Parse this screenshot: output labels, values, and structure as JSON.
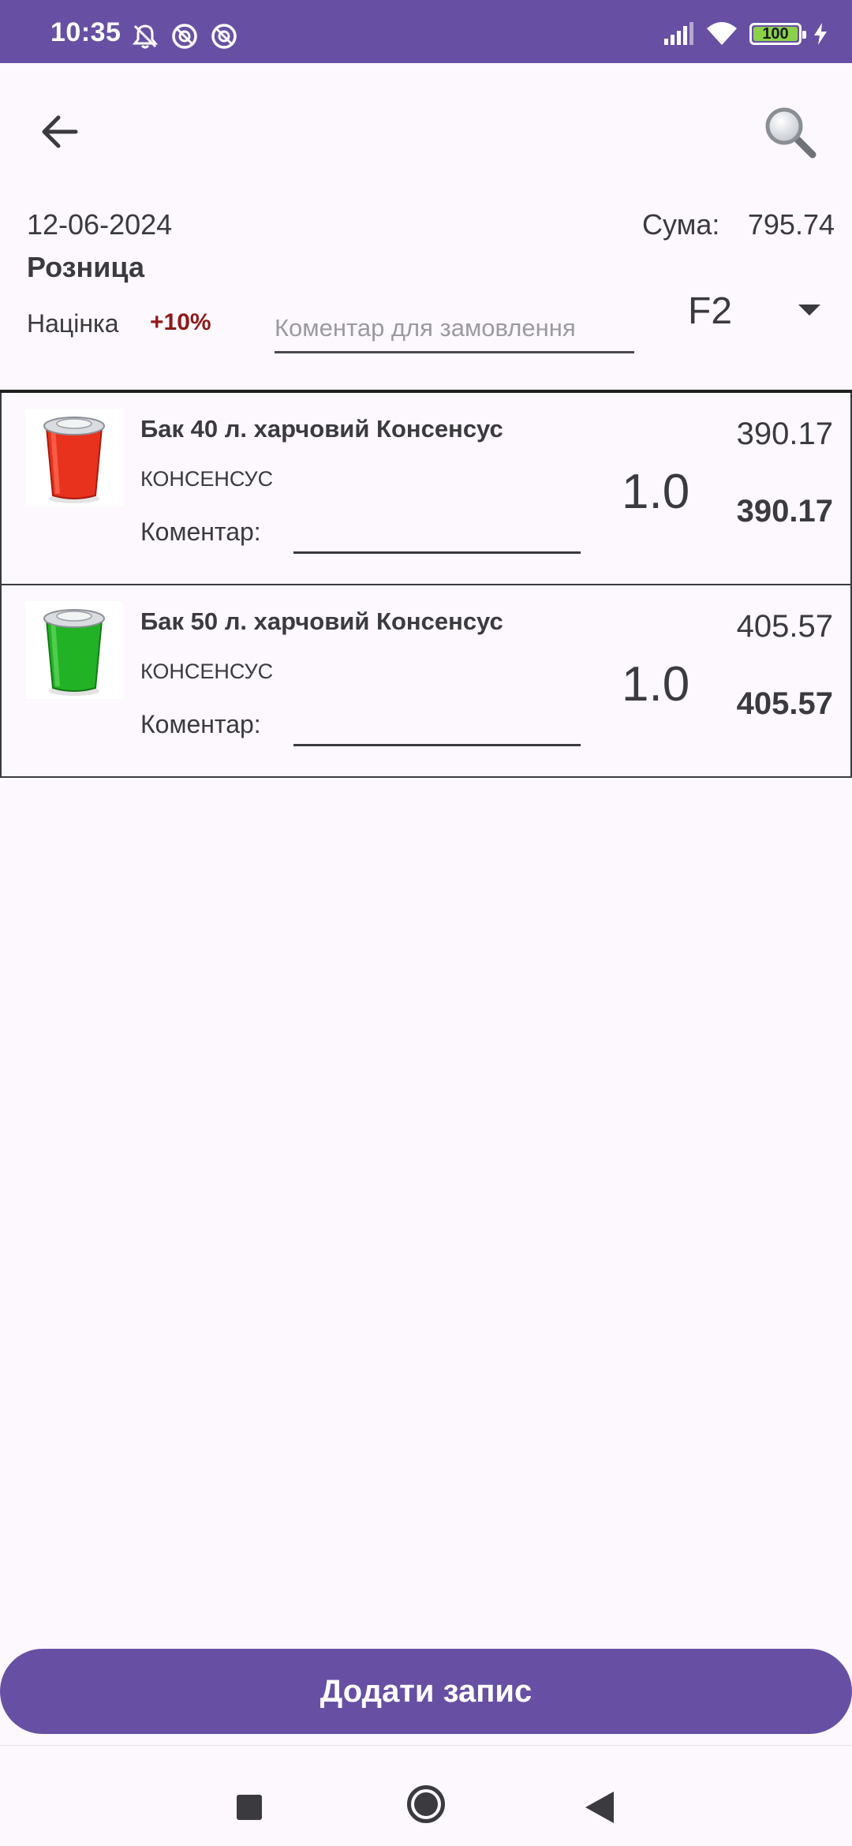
{
  "status_bar": {
    "time": "10:35",
    "battery_level": "100",
    "icons": [
      "notifications-off-icon",
      "data-saver-icon",
      "data-saver-icon",
      "signal-icon",
      "wifi-icon",
      "battery-icon",
      "charging-icon"
    ]
  },
  "toolbar": {
    "back_icon": "arrow-back-icon",
    "search_icon": "search-icon"
  },
  "header": {
    "date": "12-06-2024",
    "sum_label": "Сума:",
    "sum_value": "795.74",
    "price_type": "Розница",
    "markup_label": "Націнка",
    "markup_value": "+10%",
    "comment_placeholder": "Коментар для замовлення",
    "comment_value": "",
    "warehouse": "F2"
  },
  "products": [
    {
      "name": "Бак 40 л. харчовий Консенсус",
      "brand": "КОНСЕНСУС",
      "comment_label": "Коментар:",
      "comment_value": "",
      "quantity": "1.0",
      "price": "390.17",
      "total": "390.17",
      "thumb_color": "#E8321E"
    },
    {
      "name": "Бак 50 л. харчовий Консенсус",
      "brand": "КОНСЕНСУС",
      "comment_label": "Коментар:",
      "comment_value": "",
      "quantity": "1.0",
      "price": "405.57",
      "total": "405.57",
      "thumb_color": "#22B226"
    }
  ],
  "actions": {
    "add_label": "Додати запис"
  },
  "colors": {
    "primary": "#6750A4",
    "markup": "#8E1A1A",
    "text": "#3A3A3F",
    "background": "#FDF8FD"
  }
}
